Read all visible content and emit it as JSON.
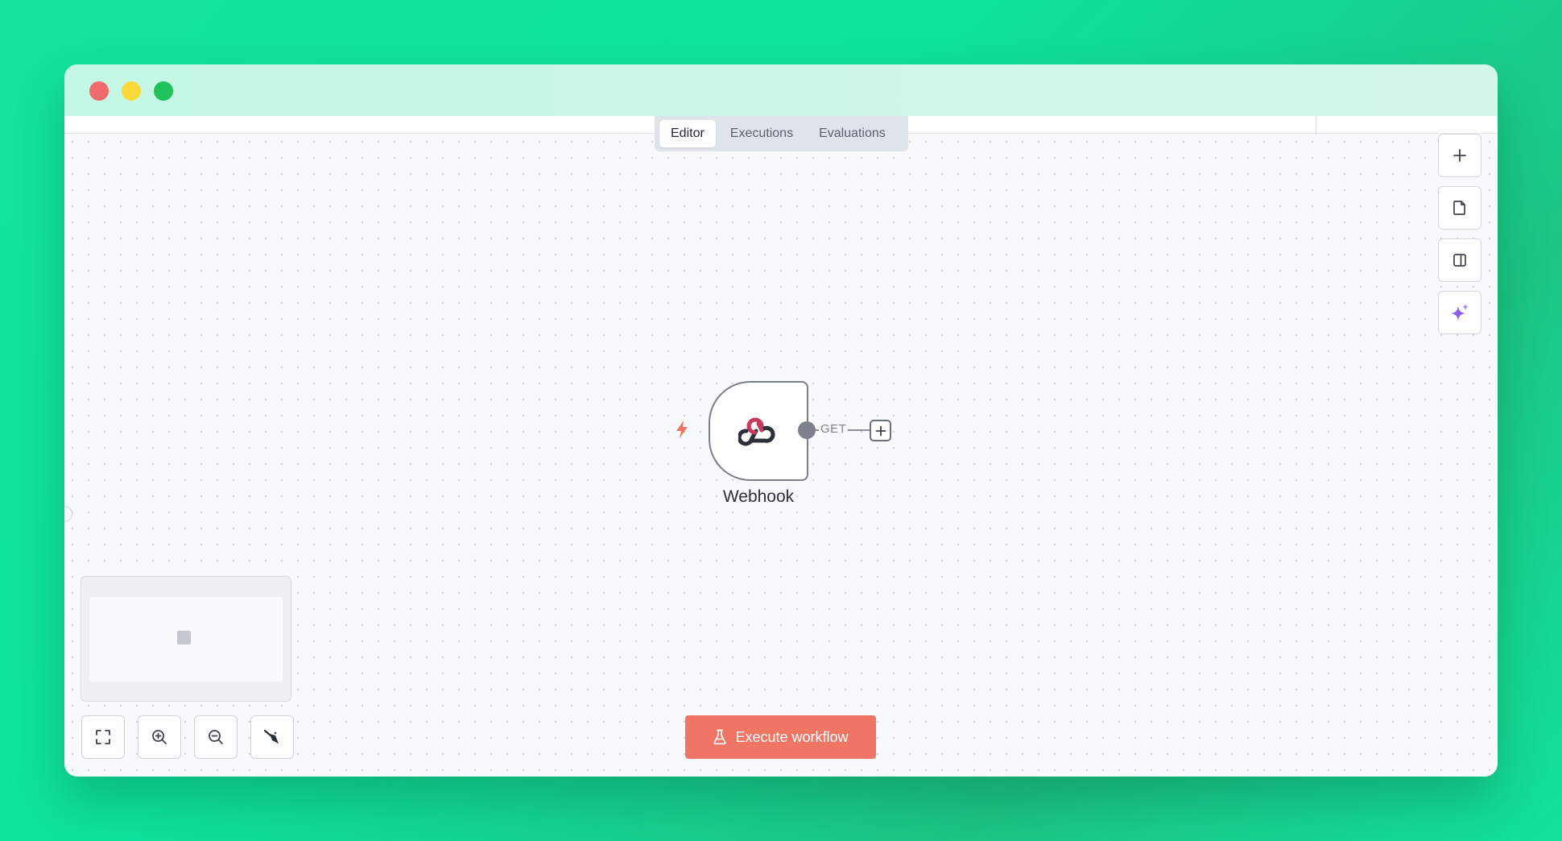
{
  "tabs": [
    {
      "label": "Editor",
      "active": true
    },
    {
      "label": "Executions",
      "active": false
    },
    {
      "label": "Evaluations",
      "active": false
    }
  ],
  "node": {
    "label": "Webhook",
    "output_label": "GET",
    "icon": "webhook-icon"
  },
  "toolbar_right": [
    "plus-icon",
    "sticky-note-icon",
    "side-panel-icon",
    "ai-sparkle-icon"
  ],
  "controls": [
    "fit-view-icon",
    "zoom-in-icon",
    "zoom-out-icon",
    "tidy-up-icon"
  ],
  "execute_button": {
    "label": "Execute workflow",
    "icon": "flask-icon"
  },
  "colors": {
    "accent": "#f07565",
    "background_green": "#12e29b",
    "sparkle": "#8b5cf6",
    "trigger": "#ea4b5f"
  }
}
